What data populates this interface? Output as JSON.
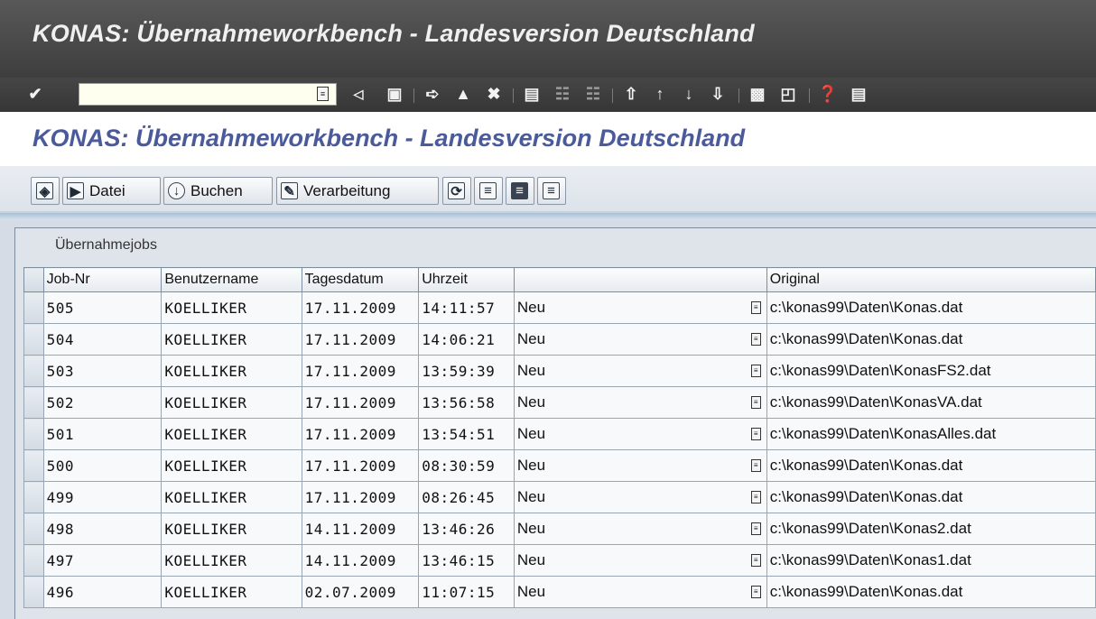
{
  "window": {
    "title": "KONAS: Übernahmeworkbench - Landesversion Deutschland"
  },
  "system_toolbar": {
    "icons": [
      "enter-icon",
      "help-f4-icon",
      "back-arrow-icon",
      "save-icon",
      "back-icon",
      "exit-icon",
      "cancel-icon",
      "print-icon",
      "find-icon",
      "find-next-icon",
      "first-page-icon",
      "previous-page-icon",
      "next-page-icon",
      "last-page-icon",
      "new-session-icon",
      "shortcut-icon",
      "help-icon",
      "layout-menu-icon"
    ]
  },
  "screen": {
    "title": "KONAS: Übernahmeworkbench - Landesversion Deutschland"
  },
  "app_toolbar": {
    "buttons": [
      {
        "label": "",
        "icon": "detail-icon"
      },
      {
        "label": "Datei",
        "icon": "file-upload-icon"
      },
      {
        "label": "Buchen",
        "icon": "post-icon"
      },
      {
        "label": "Verarbeitung",
        "icon": "edit-icon"
      },
      {
        "label": "",
        "icon": "refresh-icon"
      },
      {
        "label": "",
        "icon": "list-icon"
      },
      {
        "label": "",
        "icon": "list-dark-icon"
      },
      {
        "label": "",
        "icon": "export-icon"
      }
    ]
  },
  "panel": {
    "caption": "Übernahmejobs",
    "columns": [
      "Job-Nr",
      "Benutzername",
      "Tagesdatum",
      "Uhrzeit",
      "",
      "Original"
    ],
    "rows": [
      {
        "job": "505",
        "user": "KOELLIKER",
        "date": "17.11.2009",
        "time": "14:11:57",
        "status": "Neu",
        "original": "c:\\konas99\\Daten\\Konas.dat"
      },
      {
        "job": "504",
        "user": "KOELLIKER",
        "date": "17.11.2009",
        "time": "14:06:21",
        "status": "Neu",
        "original": "c:\\konas99\\Daten\\Konas.dat"
      },
      {
        "job": "503",
        "user": "KOELLIKER",
        "date": "17.11.2009",
        "time": "13:59:39",
        "status": "Neu",
        "original": "c:\\konas99\\Daten\\KonasFS2.dat"
      },
      {
        "job": "502",
        "user": "KOELLIKER",
        "date": "17.11.2009",
        "time": "13:56:58",
        "status": "Neu",
        "original": "c:\\konas99\\Daten\\KonasVA.dat"
      },
      {
        "job": "501",
        "user": "KOELLIKER",
        "date": "17.11.2009",
        "time": "13:54:51",
        "status": "Neu",
        "original": "c:\\konas99\\Daten\\KonasAlles.dat"
      },
      {
        "job": "500",
        "user": "KOELLIKER",
        "date": "17.11.2009",
        "time": "08:30:59",
        "status": "Neu",
        "original": "c:\\konas99\\Daten\\Konas.dat"
      },
      {
        "job": "499",
        "user": "KOELLIKER",
        "date": "17.11.2009",
        "time": "08:26:45",
        "status": "Neu",
        "original": "c:\\konas99\\Daten\\Konas.dat"
      },
      {
        "job": "498",
        "user": "KOELLIKER",
        "date": "14.11.2009",
        "time": "13:46:26",
        "status": "Neu",
        "original": "c:\\konas99\\Daten\\Konas2.dat"
      },
      {
        "job": "497",
        "user": "KOELLIKER",
        "date": "14.11.2009",
        "time": "13:46:15",
        "status": "Neu",
        "original": "c:\\konas99\\Daten\\Konas1.dat"
      },
      {
        "job": "496",
        "user": "KOELLIKER",
        "date": "02.07.2009",
        "time": "11:07:15",
        "status": "Neu",
        "original": "c:\\konas99\\Daten\\Konas.dat"
      }
    ]
  },
  "colors": {
    "title_bar": "#3e3e3e",
    "screen_title": "#4a5a9a",
    "grid_bg": "#f7f9fb"
  }
}
